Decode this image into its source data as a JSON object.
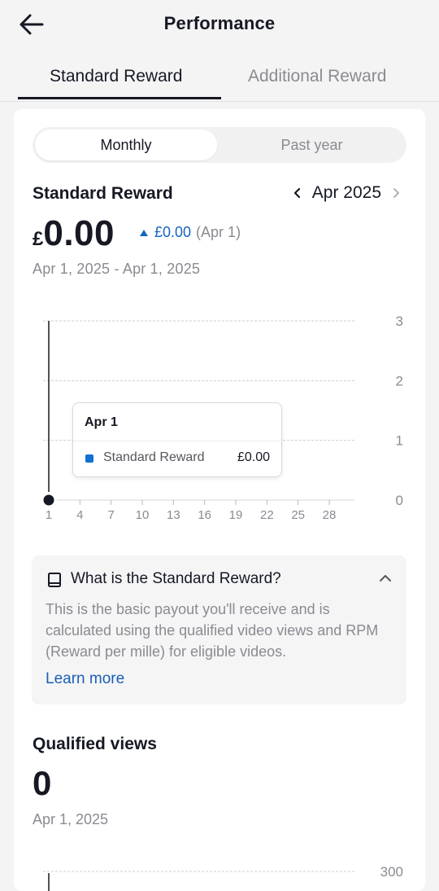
{
  "header": {
    "title": "Performance",
    "back_icon": "arrow-left-icon"
  },
  "tabs": [
    {
      "label": "Standard Reward",
      "active": true
    },
    {
      "label": "Additional Reward",
      "active": false
    }
  ],
  "period_toggle": {
    "options": [
      "Monthly",
      "Past year"
    ],
    "selected": "Monthly"
  },
  "standard_reward": {
    "title": "Standard Reward",
    "month": "Apr 2025",
    "currency": "£",
    "amount": "0.00",
    "delta_value": "£0.00",
    "delta_date": "(Apr 1)",
    "date_range": "Apr 1, 2025 - Apr 1, 2025",
    "tooltip": {
      "date": "Apr 1",
      "series": "Standard Reward",
      "value": "£0.00"
    }
  },
  "chart_data": [
    {
      "type": "line",
      "title": "",
      "x": [
        "1",
        "4",
        "7",
        "10",
        "13",
        "16",
        "19",
        "22",
        "25",
        "28"
      ],
      "yticks": [
        "0",
        "1",
        "2",
        "3"
      ],
      "ylim": [
        0,
        3
      ],
      "grid": true,
      "series": [
        {
          "name": "Standard Reward",
          "color": "#1270d0",
          "points": [
            {
              "x": 1,
              "y": 0
            }
          ]
        }
      ]
    },
    {
      "type": "line",
      "title": "",
      "yticks": [
        "300"
      ],
      "grid": true,
      "series": [
        {
          "points": []
        }
      ]
    }
  ],
  "info_box": {
    "icon": "book-icon",
    "title": "What is the Standard Reward?",
    "body": "This is the basic payout you'll receive and is calculated using the qualified video views and RPM (Reward per mille) for eligible videos.",
    "link": "Learn more"
  },
  "qualified_views": {
    "title": "Qualified views",
    "value": "0",
    "date": "Apr 1, 2025"
  },
  "colors": {
    "accent_blue": "#1270d0",
    "link_blue": "#1a5fb4",
    "text_primary": "#161823",
    "text_secondary": "#8a8b91"
  }
}
